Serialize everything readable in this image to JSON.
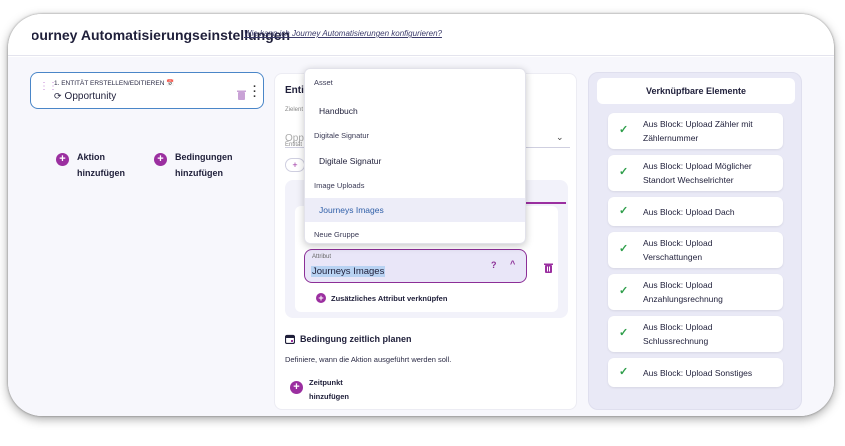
{
  "header": {
    "title": "Journey Automatisierungseinstellungen",
    "help_link": "Wie kann ich Journey Automatisierungen konfigurieren?"
  },
  "entity_card": {
    "kicker": "1. ENTITÄT ERSTELLEN/EDITIEREN",
    "name": "Opportunity"
  },
  "actions": {
    "add_action": "Aktion hinzufügen",
    "add_condition": "Bedingungen hinzufügen"
  },
  "middle_panel": {
    "title": "Entit",
    "ghost_label_1": "Zielent",
    "ghost_value": "Oppo",
    "ghost_label_2": "Entität",
    "attribute_field": {
      "label": "Attribut",
      "value": "Journeys Images"
    },
    "link_attribute": "Zusätzliches Attribut verknüpfen",
    "schedule": {
      "title": "Bedingung zeitlich planen",
      "description": "Definiere, wann die Aktion ausgeführt werden soll.",
      "add_time": "Zeitpunkt hinzufügen"
    }
  },
  "dropdown": {
    "items": [
      {
        "kind": "group",
        "label": "Asset"
      },
      {
        "kind": "option",
        "label": "Handbuch"
      },
      {
        "kind": "group",
        "label": "Digitale Signatur"
      },
      {
        "kind": "option",
        "label": "Digitale Signatur"
      },
      {
        "kind": "group",
        "label": "Image Uploads"
      },
      {
        "kind": "option",
        "label": "Journeys Images",
        "selected": true
      },
      {
        "kind": "group",
        "label": "Neue Gruppe"
      }
    ]
  },
  "right_panel": {
    "title": "Verknüpfbare Elemente",
    "items": [
      "Aus Block: Upload Zähler mit Zählernummer",
      "Aus Block: Upload Möglicher Standort Wechselrichter",
      "Aus Block: Upload Dach",
      "Aus Block: Upload Verschattungen",
      "Aus Block: Upload Anzahlungsrechnung",
      "Aus Block: Upload Schlussrechnung",
      "Aus Block: Upload Sonstiges"
    ]
  },
  "colors": {
    "accent": "#9b2fa0",
    "check": "#2e9e4a",
    "focus_border": "#4a86c8"
  }
}
